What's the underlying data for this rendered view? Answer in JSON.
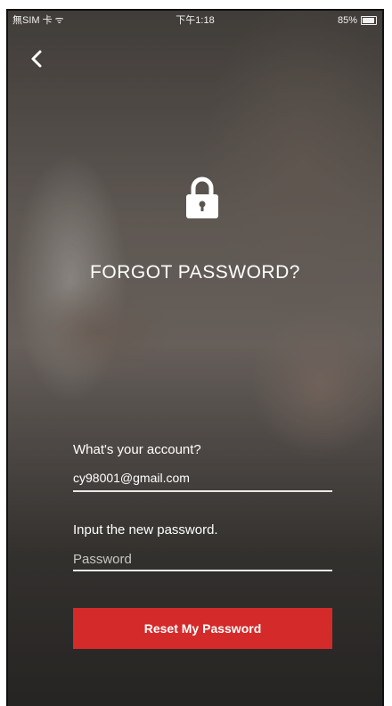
{
  "status_bar": {
    "carrier": "無SIM 卡 ᯤ",
    "time": "下午1:18",
    "battery": "85%"
  },
  "icons": {
    "back": "chevron-left-icon",
    "lock": "lock-icon"
  },
  "page": {
    "title": "FORGOT PASSWORD?"
  },
  "form": {
    "account_label": "What's your account?",
    "account_value": "cy98001@gmail.com",
    "password_label": "Input the new password.",
    "password_placeholder": "Password",
    "submit_label": "Reset My Password"
  },
  "colors": {
    "accent": "#d42a2a"
  }
}
